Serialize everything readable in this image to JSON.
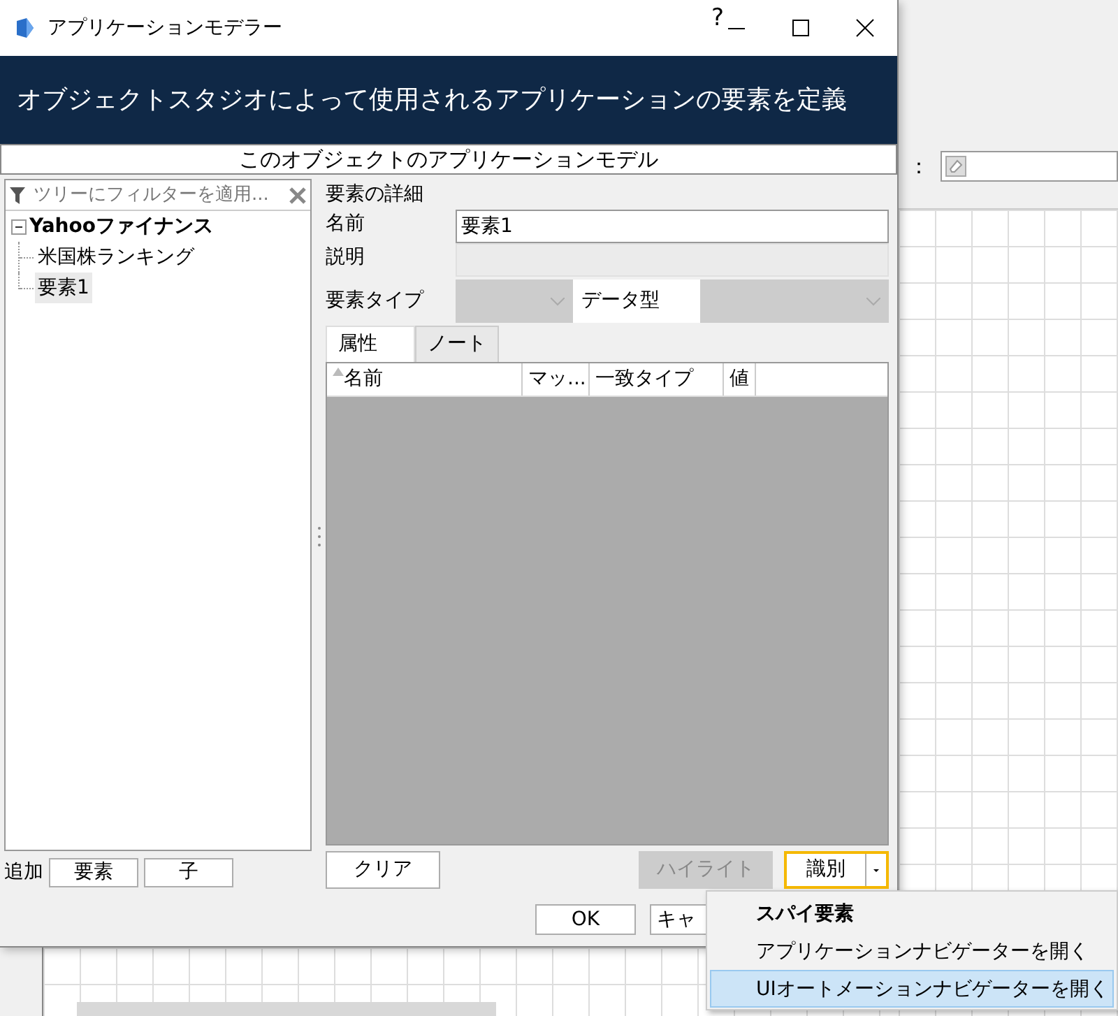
{
  "window": {
    "title": "アプリケーションモデラー",
    "help": "?"
  },
  "banner": "オブジェクトスタジオによって使用されるアプリケーションの要素を定義",
  "subtitle": "このオブジェクトのアプリケーションモデル",
  "filter": {
    "placeholder": "ツリーにフィルターを適用..."
  },
  "tree": [
    {
      "label": "Yahooファイナンス",
      "expanded": true,
      "selected": false,
      "children": [
        {
          "label": "米国株ランキング",
          "selected": false
        },
        {
          "label": "要素1",
          "selected": true
        }
      ]
    }
  ],
  "add": {
    "label": "追加",
    "buttons": [
      "要素",
      "子"
    ]
  },
  "details": {
    "heading": "要素の詳細",
    "name": {
      "label": "名前",
      "value": "要素1",
      "disabled": false
    },
    "description": {
      "label": "説明",
      "disabled": true
    },
    "element_type": {
      "label": "要素タイプ",
      "disabled": true
    },
    "data_type": {
      "label": "データ型",
      "disabled": true
    }
  },
  "tabs": [
    {
      "label": "属性",
      "selected": true
    },
    {
      "label": "ノート",
      "selected": false
    }
  ],
  "table": {
    "columns": [
      {
        "label": "名前",
        "sorted": true
      },
      {
        "label": "マッ...",
        "sorted": false
      },
      {
        "label": "一致タイプ",
        "sorted": false
      },
      {
        "label": "値",
        "sorted": false
      }
    ]
  },
  "actions": [
    {
      "label": "クリア",
      "kind": "plain",
      "disabled": false
    },
    {
      "label": "ハイライト",
      "kind": "plain",
      "disabled": true
    },
    {
      "label": "識別",
      "kind": "split",
      "disabled": false,
      "focused": true
    }
  ],
  "footer": [
    "OK",
    "キャ"
  ],
  "menu": [
    {
      "label": "スパイ要素",
      "bold": true,
      "selected": false
    },
    {
      "label": "アプリケーションナビゲーターを開く",
      "bold": false,
      "selected": false
    },
    {
      "label": "UIオートメーションナビゲーターを開く",
      "bold": false,
      "selected": true
    }
  ],
  "background": {
    "field_label": "："
  }
}
